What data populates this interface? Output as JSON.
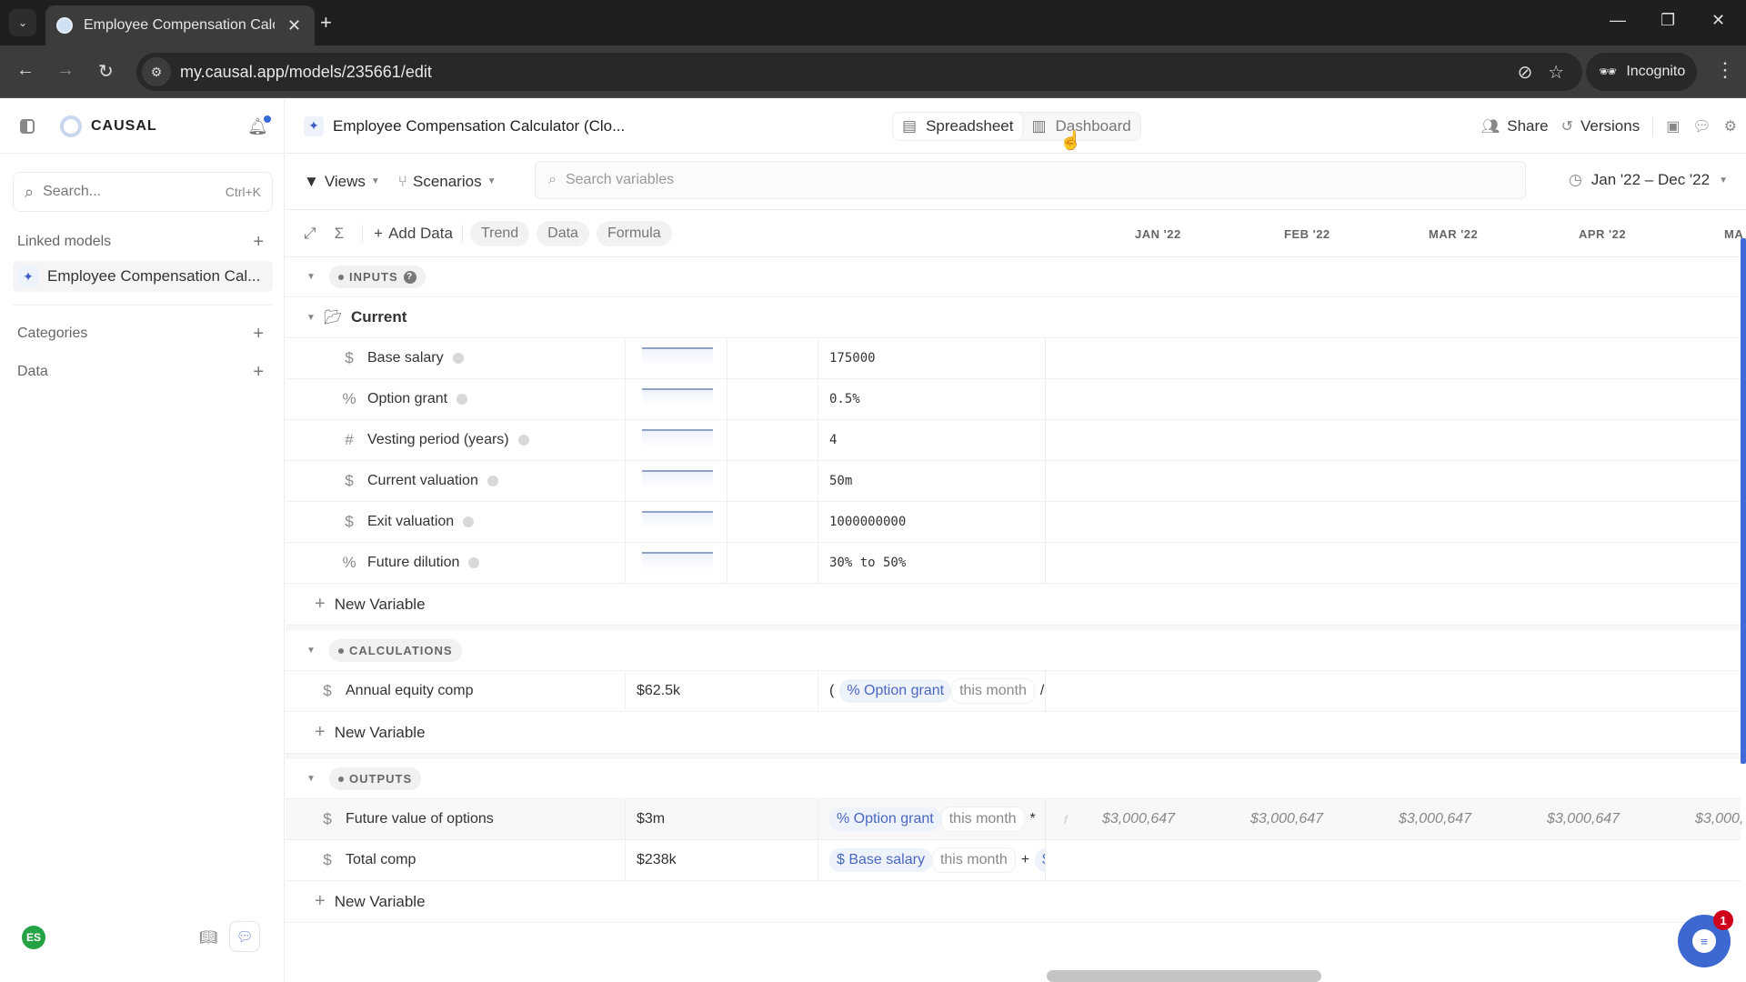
{
  "browser": {
    "tab_title": "Employee Compensation Calcu",
    "url": "my.causal.app/models/235661/edit",
    "incognito_label": "Incognito"
  },
  "sidebar": {
    "logo": "CAUSAL",
    "search_placeholder": "Search...",
    "search_shortcut": "Ctrl+K",
    "linked_models_label": "Linked models",
    "linked_models": [
      {
        "label": "Employee Compensation Cal..."
      }
    ],
    "categories_label": "Categories",
    "data_label": "Data",
    "user_initials": "ES"
  },
  "header": {
    "model_title": "Employee Compensation Calculator (Clo...",
    "views": {
      "spreadsheet": "Spreadsheet",
      "dashboard": "Dashboard",
      "active": "Spreadsheet"
    },
    "share": "Share",
    "versions": "Versions"
  },
  "toolbar": {
    "views": "Views",
    "scenarios": "Scenarios",
    "search_placeholder": "Search variables",
    "date_range": "Jan '22 – Dec '22",
    "add_data": "Add Data",
    "pills": [
      "Trend",
      "Data",
      "Formula"
    ],
    "months": [
      "JAN '22",
      "FEB '22",
      "MAR '22",
      "APR '22",
      "MA"
    ]
  },
  "sections": {
    "inputs": {
      "label": "INPUTS",
      "folder": "Current",
      "rows": [
        {
          "icon": "$",
          "name": "Base salary",
          "value": "175000"
        },
        {
          "icon": "%",
          "name": "Option grant",
          "value": "0.5%"
        },
        {
          "icon": "#",
          "name": "Vesting period (years)",
          "value": "4"
        },
        {
          "icon": "$",
          "name": "Current valuation",
          "value": "50m"
        },
        {
          "icon": "$",
          "name": "Exit valuation",
          "value": "1000000000"
        },
        {
          "icon": "%",
          "name": "Future dilution",
          "value": "30% to 50%"
        }
      ]
    },
    "calculations": {
      "label": "CALCULATIONS",
      "rows": [
        {
          "icon": "$",
          "name": "Annual equity comp",
          "summary": "$62.5k",
          "formula_prefix": "(",
          "token": "% Option grant",
          "period": "this month",
          "op": "/"
        }
      ]
    },
    "outputs": {
      "label": "OUTPUTS",
      "rows": [
        {
          "icon": "$",
          "name": "Future value of options",
          "summary": "$3m",
          "token": "% Option grant",
          "period": "this month",
          "op": "*",
          "monthly": [
            "$3,000,647",
            "$3,000,647",
            "$3,000,647",
            "$3,000,647",
            "$3,000,"
          ]
        },
        {
          "icon": "$",
          "name": "Total comp",
          "summary": "$238k",
          "token": "$ Base salary",
          "period": "this month",
          "op": "+",
          "trail": "$"
        }
      ]
    },
    "new_variable": "New Variable"
  },
  "help": {
    "badge_count": "1"
  }
}
